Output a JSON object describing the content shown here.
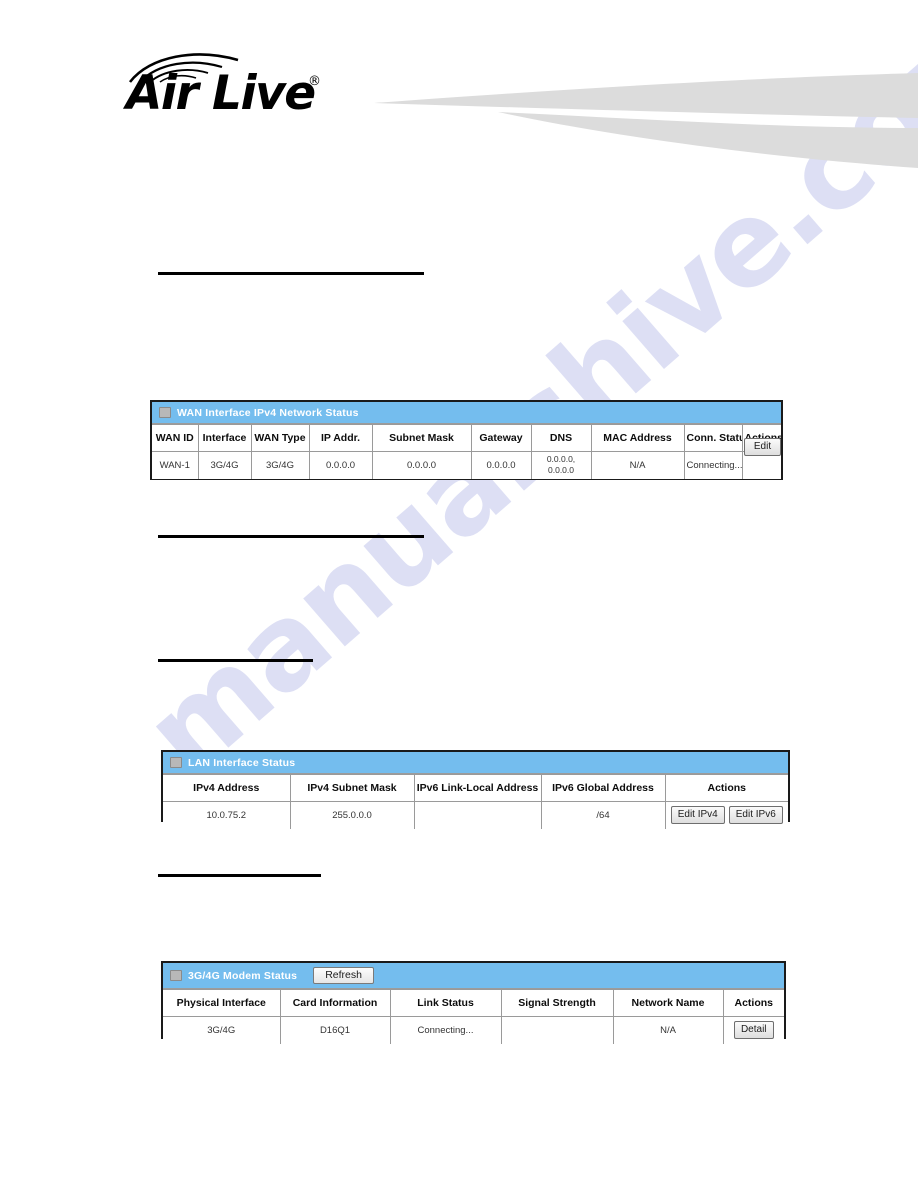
{
  "brand": {
    "logo_text": "Air Live",
    "registered_mark": "®",
    "logo_icon": "wireless-arcs-icon"
  },
  "watermark": {
    "text": "manualshive.com"
  },
  "sections": [
    {
      "name": "section-rule-1"
    },
    {
      "name": "section-rule-2"
    },
    {
      "name": "section-rule-3"
    },
    {
      "name": "section-rule-4"
    }
  ],
  "wan_panel": {
    "title": "WAN Interface IPv4 Network Status",
    "icon": "monitor-icon",
    "columns": [
      "WAN ID",
      "Interface",
      "WAN Type",
      "IP Addr.",
      "Subnet Mask",
      "Gateway",
      "DNS",
      "MAC Address",
      "Conn. Status",
      "Actions"
    ],
    "rows": [
      {
        "wan_id": "WAN-1",
        "interface": "3G/4G",
        "wan_type": "3G/4G",
        "ip_addr": "0.0.0.0",
        "subnet_mask": "0.0.0.0",
        "gateway": "0.0.0.0",
        "dns_line1": "0.0.0.0,",
        "dns_line2": "0.0.0.0",
        "mac_address": "N/A",
        "conn_status": "Connecting...",
        "action_label": "Edit"
      }
    ]
  },
  "lan_panel": {
    "title": "LAN Interface Status",
    "icon": "monitor-icon",
    "columns": [
      "IPv4 Address",
      "IPv4 Subnet Mask",
      "IPv6 Link-Local Address",
      "IPv6 Global Address",
      "Actions"
    ],
    "rows": [
      {
        "ipv4_address": "10.0.75.2",
        "ipv4_subnet_mask": "255.0.0.0",
        "ipv6_link_local": "",
        "ipv6_global": "/64",
        "action_ipv4_label": "Edit IPv4",
        "action_ipv6_label": "Edit IPv6"
      }
    ]
  },
  "modem_panel": {
    "title": "3G/4G Modem Status",
    "icon": "monitor-icon",
    "refresh_label": "Refresh",
    "columns": [
      "Physical Interface",
      "Card Information",
      "Link Status",
      "Signal Strength",
      "Network Name",
      "Actions"
    ],
    "rows": [
      {
        "physical_interface": "3G/4G",
        "card_information": "D16Q1",
        "link_status": "Connecting...",
        "signal_strength": "",
        "network_name": "N/A",
        "action_label": "Detail"
      }
    ]
  },
  "colors": {
    "panel_header_blue": "#74bdee",
    "panel_border": "#1a1a1a",
    "grid_border": "#9a9a9a",
    "swoosh_grey": "#dcdcdc",
    "watermark": "#c9cdee"
  }
}
